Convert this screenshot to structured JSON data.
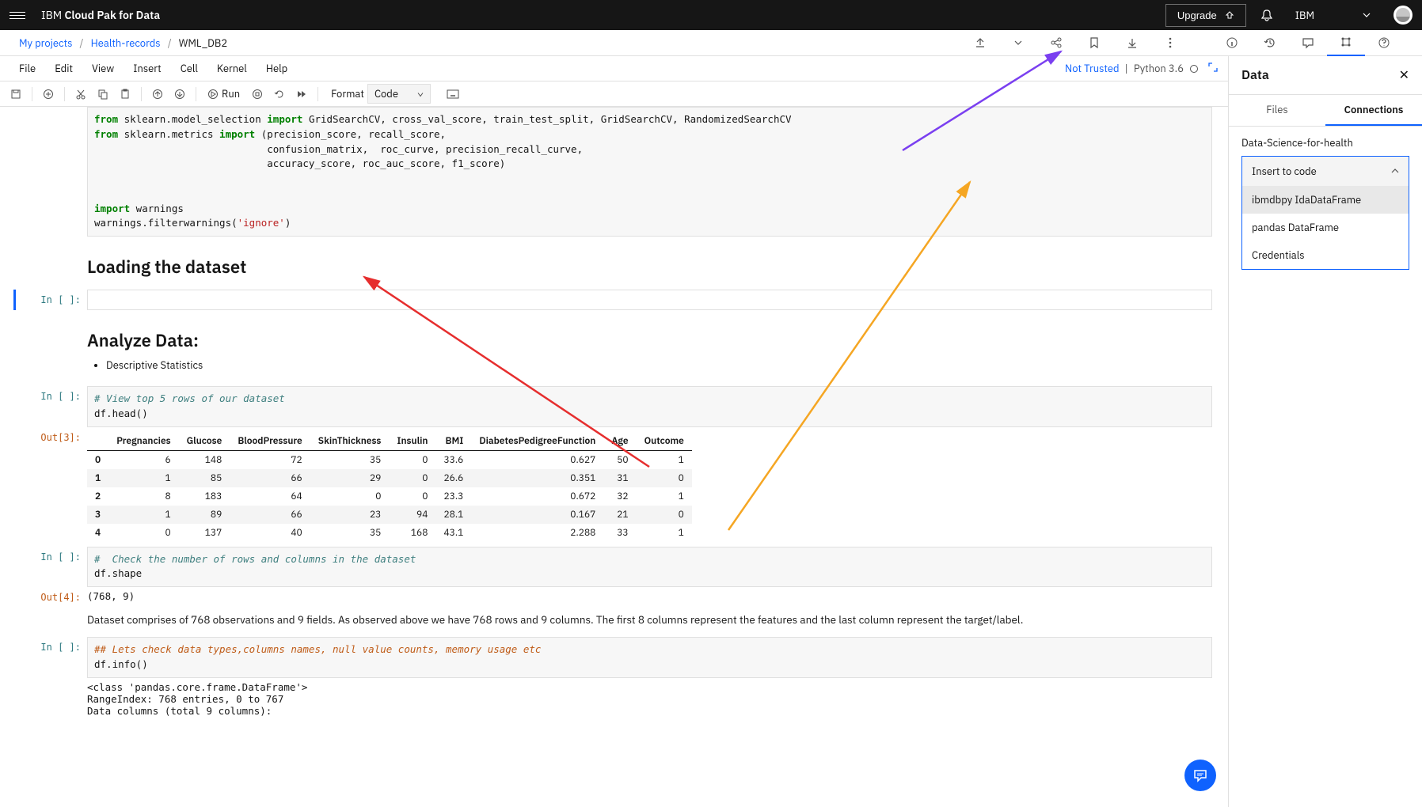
{
  "brand_prefix": "IBM",
  "brand_main": "Cloud Pak for Data",
  "upgrade_label": "Upgrade",
  "account_label": "IBM",
  "breadcrumb": {
    "root": "My projects",
    "level1": "Health-records",
    "current": "WML_DB2"
  },
  "menu": {
    "file": "File",
    "edit": "Edit",
    "view": "View",
    "insert": "Insert",
    "cell": "Cell",
    "kernel": "Kernel",
    "help": "Help"
  },
  "trust": "Not Trusted",
  "kernel_name": "Python 3.6",
  "run_label": "Run",
  "format_label": "Format",
  "cell_type": "Code",
  "headings": {
    "loading": "Loading the dataset",
    "analyze": "Analyze Data:"
  },
  "bullet": "Descriptive Statistics",
  "empty_prompt": "In [ ]:",
  "out3": "Out[3]:",
  "out4": "Out[4]:",
  "code_imports_line1_a": "from",
  "code_imports_line1_b": " sklearn.model_selection ",
  "code_imports_line1_c": "import",
  "code_imports_line1_d": " GridSearchCV, cross_val_score, train_test_split, GridSearchCV, RandomizedSearchCV",
  "code_imports_line2_a": "from",
  "code_imports_line2_b": " sklearn.metrics ",
  "code_imports_line2_c": "import",
  "code_imports_line2_d": " (precision_score, recall_score,",
  "code_imports_line3": "                             confusion_matrix,  roc_curve, precision_recall_curve,",
  "code_imports_line4": "                             accuracy_score, roc_auc_score, f1_score)",
  "code_imports_line5_a": "import",
  "code_imports_line5_b": " warnings",
  "code_imports_line6_a": "warnings.filterwarnings(",
  "code_imports_line6_b": "'ignore'",
  "code_imports_line6_c": ")",
  "code_head_comment": "# View top 5 rows of our dataset",
  "code_head": "df.head()",
  "code_shape_comment": "#  Check the number of rows and columns in the dataset",
  "code_shape": "df.shape",
  "shape_output": "(768, 9)",
  "dataset_descr": "Dataset comprises of 768 observations and 9 fields. As observed above we have 768 rows and 9 columns. The first 8 columns represent the features and the last column represent the target/label.",
  "code_info_comment": "## Lets check data types,columns names, null value counts, memory usage etc",
  "code_info": "df.info()",
  "info_out_1": "<class 'pandas.core.frame.DataFrame'>",
  "info_out_2": "RangeIndex: 768 entries, 0 to 767",
  "info_out_3": "Data columns (total 9 columns):",
  "table": {
    "cols": [
      "Pregnancies",
      "Glucose",
      "BloodPressure",
      "SkinThickness",
      "Insulin",
      "BMI",
      "DiabetesPedigreeFunction",
      "Age",
      "Outcome"
    ],
    "rows": [
      {
        "idx": "0",
        "v": [
          "6",
          "148",
          "72",
          "35",
          "0",
          "33.6",
          "0.627",
          "50",
          "1"
        ]
      },
      {
        "idx": "1",
        "v": [
          "1",
          "85",
          "66",
          "29",
          "0",
          "26.6",
          "0.351",
          "31",
          "0"
        ]
      },
      {
        "idx": "2",
        "v": [
          "8",
          "183",
          "64",
          "0",
          "0",
          "23.3",
          "0.672",
          "32",
          "1"
        ]
      },
      {
        "idx": "3",
        "v": [
          "1",
          "89",
          "66",
          "23",
          "94",
          "28.1",
          "0.167",
          "21",
          "0"
        ]
      },
      {
        "idx": "4",
        "v": [
          "0",
          "137",
          "40",
          "35",
          "168",
          "43.1",
          "2.288",
          "33",
          "1"
        ]
      }
    ]
  },
  "panel": {
    "title": "Data",
    "tab_files": "Files",
    "tab_connections": "Connections",
    "connection_name": "Data-Science-for-health",
    "insert_label": "Insert to code",
    "opt1": "ibmdbpy IdaDataFrame",
    "opt2": "pandas DataFrame",
    "opt3": "Credentials"
  }
}
